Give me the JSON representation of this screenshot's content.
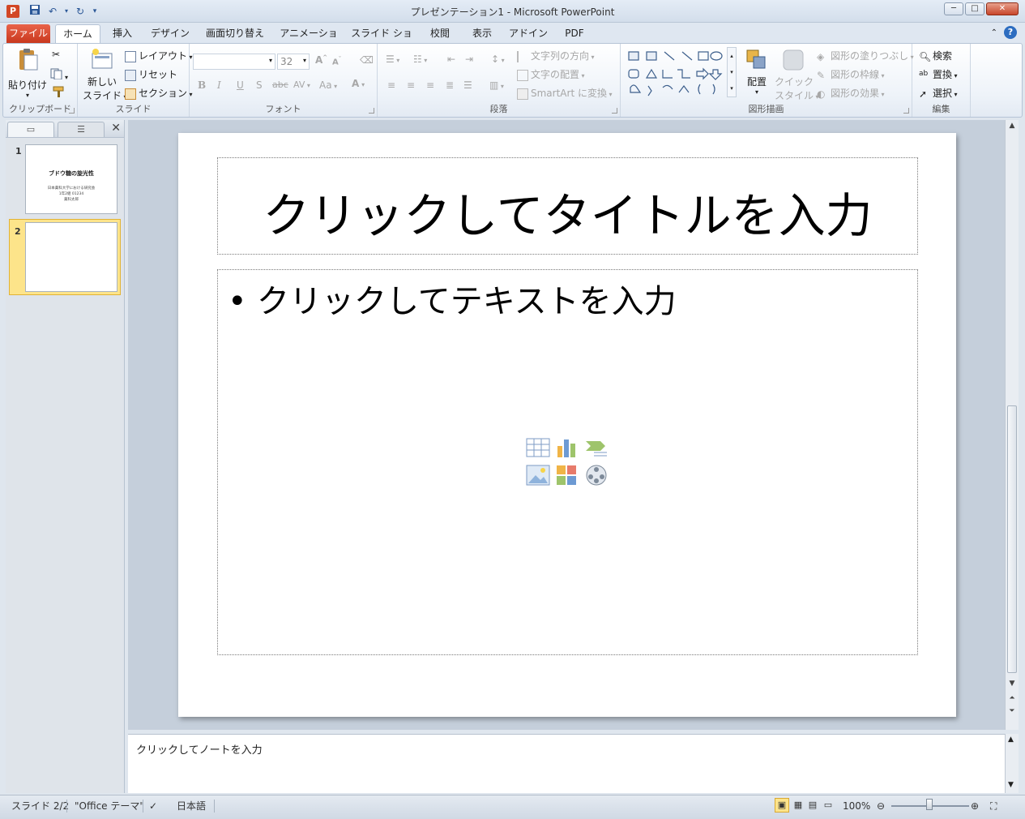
{
  "window": {
    "title": "プレゼンテーション1 - Microsoft PowerPoint",
    "app_icon": "P",
    "controls": {
      "minimize": "─",
      "maximize": "□",
      "close": "✕"
    }
  },
  "tabs": {
    "file": "ファイル",
    "home": "ホーム",
    "insert": "挿入",
    "design": "デザイン",
    "transitions": "画面切り替え",
    "animations": "アニメーション",
    "slideshow": "スライド ショー",
    "review": "校閲",
    "view": "表示",
    "addin": "アドイン",
    "pdf": "PDF",
    "help": "?"
  },
  "ribbon": {
    "clipboard": {
      "label": "クリップボード",
      "paste": "貼り付け"
    },
    "slides": {
      "label": "スライド",
      "new_slide_1": "新しい",
      "new_slide_2": "スライド",
      "layout": "レイアウト",
      "reset": "リセット",
      "section": "セクション"
    },
    "font": {
      "label": "フォント",
      "font_name": "",
      "font_size": "32",
      "bold": "B",
      "italic": "I",
      "underline": "U",
      "shadow": "S",
      "strike": "abc",
      "spacing": "AV",
      "case": "Aa",
      "color": "A"
    },
    "paragraph": {
      "label": "段落",
      "text_direction": "文字列の方向",
      "align_text": "文字の配置",
      "smartart": "SmartArt に変換"
    },
    "drawing": {
      "label": "図形描画",
      "arrange": "配置",
      "quick_styles_1": "クイック",
      "quick_styles_2": "スタイル",
      "shape_fill": "図形の塗りつぶし",
      "shape_outline": "図形の枠線",
      "shape_effects": "図形の効果"
    },
    "editing": {
      "label": "編集",
      "find": "検索",
      "replace": "置換",
      "select": "選択"
    }
  },
  "slides_panel": {
    "slides": [
      {
        "number": "1",
        "title": "ブドウ糖の旋光性",
        "lines": [
          "日本薬科大学における研究会",
          "1年2組 01234",
          "薬科太郎"
        ]
      },
      {
        "number": "2"
      }
    ]
  },
  "slide": {
    "title_placeholder": "クリックしてタイトルを入力",
    "body_placeholder": "クリックしてテキストを入力",
    "bullet": "•"
  },
  "notes": {
    "placeholder": "クリックしてノートを入力"
  },
  "status": {
    "slide_count": "スライド 2/2",
    "theme": "\"Office テーマ\"",
    "language": "日本語",
    "zoom": "100%"
  }
}
